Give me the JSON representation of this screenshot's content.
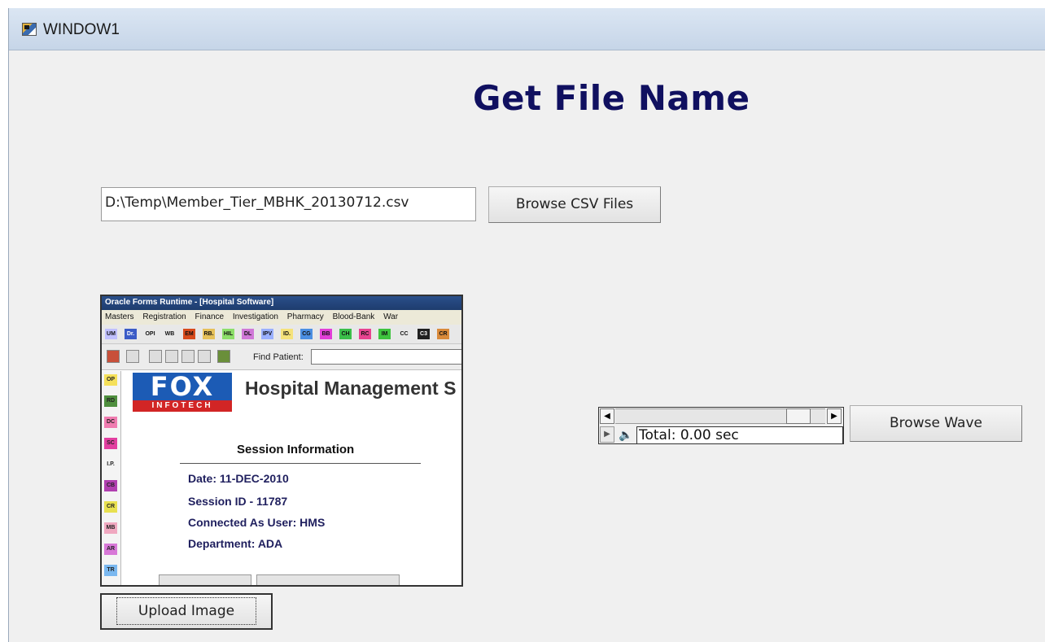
{
  "window": {
    "title": "WINDOW1"
  },
  "heading": "Get File Name",
  "csv": {
    "path_value": "D:\\Temp\\Member_Tier_MBHK_20130712.csv",
    "browse_label": "Browse CSV Files"
  },
  "image_preview": {
    "title": "Oracle Forms Runtime - [Hospital Software]",
    "menu": [
      "Masters",
      "Registration",
      "Finance",
      "Investigation",
      "Pharmacy",
      "Blood-Bank",
      "War"
    ],
    "toolbar_chips": [
      {
        "label": "UM",
        "color": "#c0c0ff"
      },
      {
        "label": "Dr.",
        "color": "#3a5bc7"
      },
      {
        "label": "OPI",
        "color": "#e8e8e8"
      },
      {
        "label": "WB",
        "color": "#e8e8e8"
      },
      {
        "label": "EM",
        "color": "#d84b1c"
      },
      {
        "label": "RB.",
        "color": "#e6c15a"
      },
      {
        "label": "HIL",
        "color": "#8ddf6a"
      },
      {
        "label": "DL",
        "color": "#d078d8"
      },
      {
        "label": "IPV",
        "color": "#9ab0ff"
      },
      {
        "label": "ID.",
        "color": "#f5e27a"
      },
      {
        "label": "CG",
        "color": "#4b8fe3"
      },
      {
        "label": "BB",
        "color": "#e23fd8"
      },
      {
        "label": "CH",
        "color": "#3bbf4a"
      },
      {
        "label": "RC",
        "color": "#e84390"
      },
      {
        "label": "IM",
        "color": "#3ec43e"
      },
      {
        "label": "CC",
        "color": "#e8e8e8"
      },
      {
        "label": "C3",
        "color": "#202020"
      },
      {
        "label": "CR",
        "color": "#d98a3a"
      }
    ],
    "find_label": "Find Patient:",
    "side_chips": [
      {
        "label": "OP",
        "color": "#f5e05a"
      },
      {
        "label": "RD",
        "color": "#4f8f3e"
      },
      {
        "label": "DC",
        "color": "#f07cb0"
      },
      {
        "label": "SC",
        "color": "#e23fa0"
      },
      {
        "label": "I.P.",
        "color": "#f4f4f4"
      },
      {
        "label": "CB",
        "color": "#b13fb0"
      },
      {
        "label": "CR",
        "color": "#e8e050"
      },
      {
        "label": "MB",
        "color": "#f0a8c0"
      },
      {
        "label": "AR",
        "color": "#d878d8"
      },
      {
        "label": "TR",
        "color": "#7ab8f0"
      }
    ],
    "logo_text": "FOX",
    "logo_sub": "INFOTECH",
    "app_heading": "Hospital Management S",
    "session_title": "Session Information",
    "session_lines": [
      "Date: 11-DEC-2010",
      "Session ID - 11787",
      "Connected As User: HMS",
      "Department: ADA"
    ]
  },
  "upload_label": "Upload Image",
  "wave": {
    "total_text": "Total: 0.00 sec",
    "browse_label": "Browse Wave"
  }
}
